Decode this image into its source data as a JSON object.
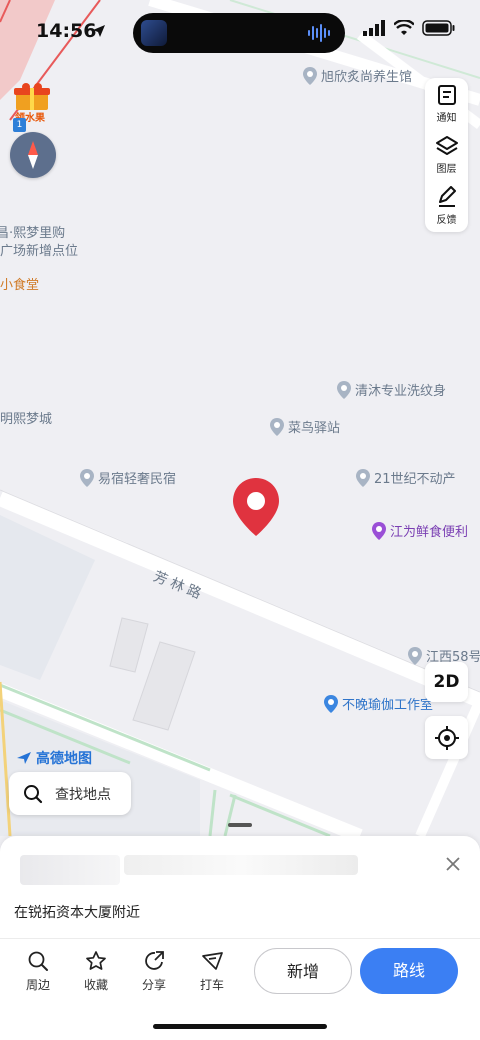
{
  "status_bar": {
    "time": "14:56"
  },
  "map": {
    "road_label": "芳林路",
    "pois": [
      {
        "name": "旭欣炙尚养生馆",
        "style": "gray"
      },
      {
        "name": "昌·熙梦里购",
        "style": "gray"
      },
      {
        "name": "广场新增点位",
        "style": "gray"
      },
      {
        "name": "小食堂",
        "style": "orange"
      },
      {
        "name": "清沐专业洗纹身",
        "style": "gray"
      },
      {
        "name": "明熙梦城",
        "style": "gray"
      },
      {
        "name": "菜鸟驿站",
        "style": "gray"
      },
      {
        "name": "易宿轻奢民宿",
        "style": "gray"
      },
      {
        "name": "21世纪不动产",
        "style": "gray"
      },
      {
        "name": "江为鲜食便利",
        "style": "purple"
      },
      {
        "name": "江西58号",
        "style": "gray"
      },
      {
        "name": "不晚瑜伽工作室",
        "style": "blue"
      }
    ]
  },
  "gift": {
    "label": "领水果"
  },
  "compass": {
    "badge": "1"
  },
  "tools": [
    {
      "label": "通知",
      "icon": "notice-icon"
    },
    {
      "label": "图层",
      "icon": "layers-icon"
    },
    {
      "label": "反馈",
      "icon": "feedback-icon"
    }
  ],
  "view_toggle": "2D",
  "brand": "高德地图",
  "search": {
    "placeholder": "查找地点"
  },
  "sheet": {
    "address": "在锐拓资本大厦附近",
    "actions": [
      {
        "label": "周边",
        "icon": "search-icon"
      },
      {
        "label": "收藏",
        "icon": "star-icon"
      },
      {
        "label": "分享",
        "icon": "share-icon"
      },
      {
        "label": "打车",
        "icon": "taxi-icon"
      }
    ],
    "add_button": "新增",
    "route_button": "路线"
  },
  "colors": {
    "accent": "#3b7ff3",
    "marker": "#e0333f"
  }
}
